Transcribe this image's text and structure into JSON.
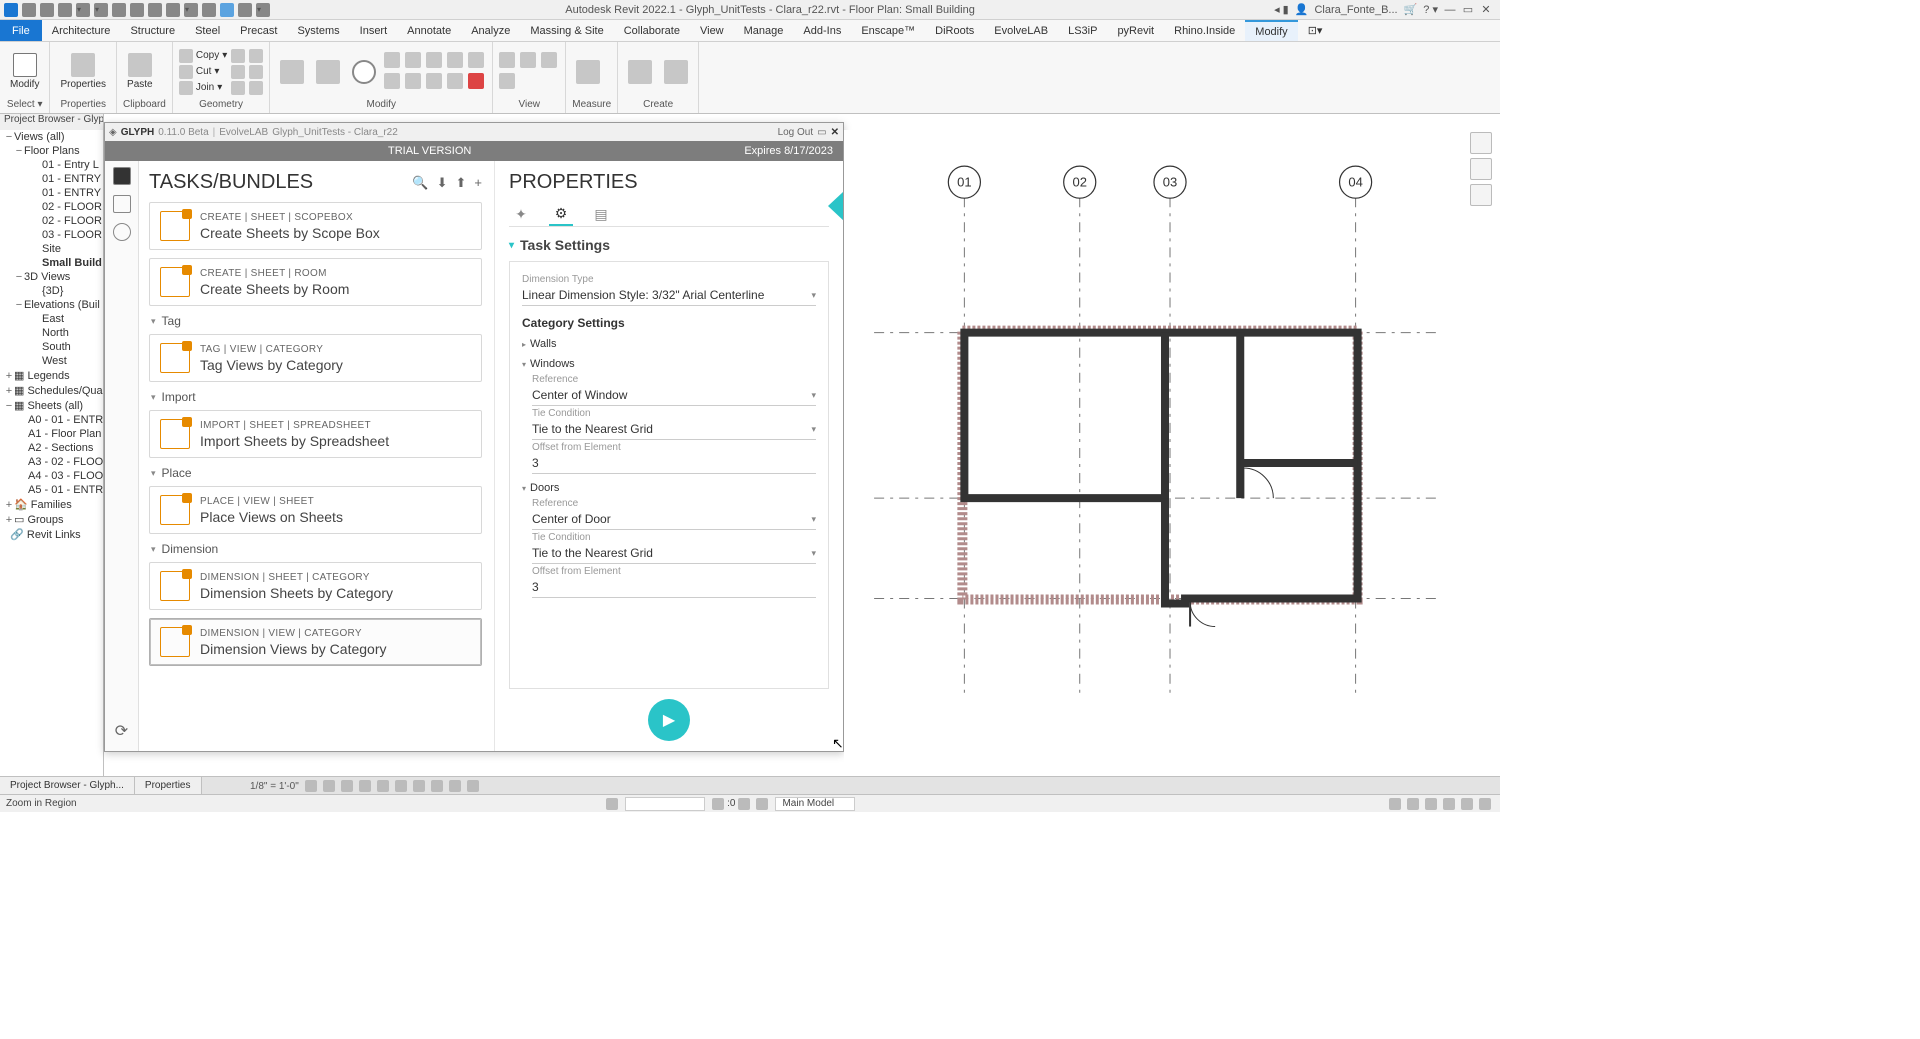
{
  "titlebar": {
    "center_text": "Autodesk Revit 2022.1 - Glyph_UnitTests - Clara_r22.rvt - Floor Plan: Small Building",
    "user": "Clara_Fonte_B..."
  },
  "ribbon": {
    "file": "File",
    "tabs": [
      "Architecture",
      "Structure",
      "Steel",
      "Precast",
      "Systems",
      "Insert",
      "Annotate",
      "Analyze",
      "Massing & Site",
      "Collaborate",
      "View",
      "Manage",
      "Add-Ins",
      "Enscape™",
      "DiRoots",
      "EvolveLAB",
      "LS3iP",
      "pyRevit",
      "Rhino.Inside",
      "Modify"
    ],
    "active": "Modify",
    "panels": {
      "select": "Select ▾",
      "modify_big": "Modify",
      "properties": "Properties",
      "clipboard": "Clipboard",
      "paste": "Paste",
      "copy": "Copy",
      "cut": "Cut",
      "join": "Join",
      "geometry": "Geometry",
      "modify": "Modify",
      "view": "View",
      "measure": "Measure",
      "create": "Create"
    }
  },
  "browser": {
    "title": "Project Browser - Glyph...",
    "root": "Views (all)",
    "floorplans": "Floor Plans",
    "fp_items": [
      "01 - Entry L",
      "01 - ENTRY",
      "01 - ENTRY",
      "02 - FLOOR",
      "02 - FLOOR",
      "03 - FLOOR",
      "Site",
      "Small Build"
    ],
    "threed": "3D Views",
    "threed_items": [
      "{3D}"
    ],
    "elev": "Elevations (Buil",
    "elev_items": [
      "East",
      "North",
      "South",
      "West"
    ],
    "legends": "Legends",
    "schedules": "Schedules/Quan",
    "sheets": "Sheets (all)",
    "sheet_items": [
      "A0 - 01 - ENTR",
      "A1 - Floor Plan",
      "A2 - Sections",
      "A3 - 02 - FLOO",
      "A4 - 03 - FLOO",
      "A5 - 01 - ENTR"
    ],
    "families": "Families",
    "groups": "Groups",
    "revitlinks": "Revit Links"
  },
  "glyph": {
    "name": "GLYPH",
    "version": "0.11.0 Beta",
    "vendor": "EvolveLAB",
    "doc": "Glyph_UnitTests - Clara_r22",
    "logout": "Log Out",
    "trial": "TRIAL VERSION",
    "expires": "Expires 8/17/2023",
    "tasks_title": "TASKS/BUNDLES",
    "props_title": "PROPERTIES",
    "tasks": [
      {
        "path": "CREATE  |  SHEET  |  SCOPEBOX",
        "title": "Create Sheets by Scope Box"
      },
      {
        "path": "CREATE  |  SHEET  |  ROOM",
        "title": "Create Sheets by Room"
      }
    ],
    "group_tag": "Tag",
    "task_tag": {
      "path": "TAG  |  VIEW  |  CATEGORY",
      "title": "Tag Views by Category"
    },
    "group_import": "Import",
    "task_import": {
      "path": "IMPORT  |  SHEET  |  SPREADSHEET",
      "title": "Import Sheets by Spreadsheet"
    },
    "group_place": "Place",
    "task_place": {
      "path": "PLACE  |  VIEW  |  SHEET",
      "title": "Place Views on Sheets"
    },
    "group_dim": "Dimension",
    "task_dim1": {
      "path": "DIMENSION  |  SHEET  |  CATEGORY",
      "title": "Dimension Sheets by Category"
    },
    "task_dim2": {
      "path": "DIMENSION  |  VIEW  |  CATEGORY",
      "title": "Dimension Views by Category"
    },
    "section_tasksettings": "Task Settings",
    "dimtype_label": "Dimension Type",
    "dimtype_value": "Linear Dimension Style: 3/32\" Arial Centerline",
    "catsettings": "Category Settings",
    "walls": "Walls",
    "windows": "Windows",
    "doors": "Doors",
    "ref_label": "Reference",
    "win_ref": "Center of Window",
    "door_ref": "Center of Door",
    "tie_label": "Tie Condition",
    "tie_value": "Tie to the Nearest Grid",
    "offset_label": "Offset from Element",
    "offset_value": "3"
  },
  "canvas": {
    "grids": [
      "01",
      "02",
      "03",
      "04"
    ]
  },
  "bottom": {
    "tab1": "Project Browser - Glyph...",
    "tab2": "Properties",
    "scale": "1/8\" = 1'-0\"",
    "status": "Zoom in Region",
    "zero": ":0",
    "workset": "Main Model"
  }
}
